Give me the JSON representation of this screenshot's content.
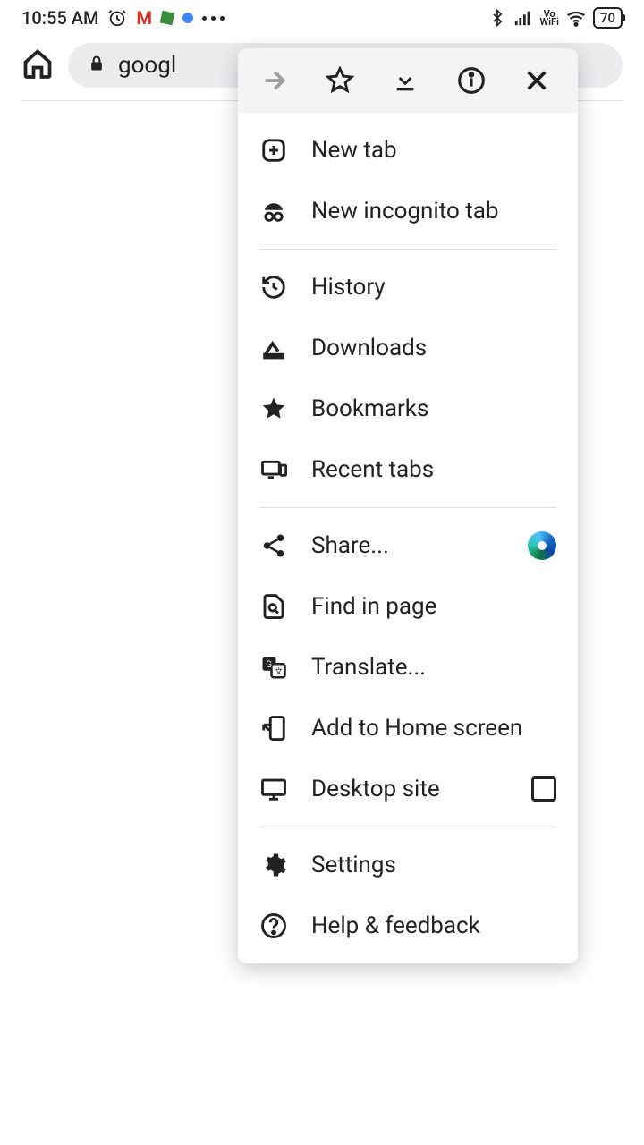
{
  "status": {
    "time": "10:55 AM",
    "battery": "70"
  },
  "toolbar": {
    "url_text": "googl"
  },
  "menu": {
    "new_tab": "New tab",
    "incognito": "New incognito tab",
    "history": "History",
    "downloads": "Downloads",
    "bookmarks": "Bookmarks",
    "recent_tabs": "Recent tabs",
    "share": "Share...",
    "find": "Find in page",
    "translate": "Translate...",
    "add_home": "Add to Home screen",
    "desktop": "Desktop site",
    "settings": "Settings",
    "help": "Help & feedback"
  }
}
